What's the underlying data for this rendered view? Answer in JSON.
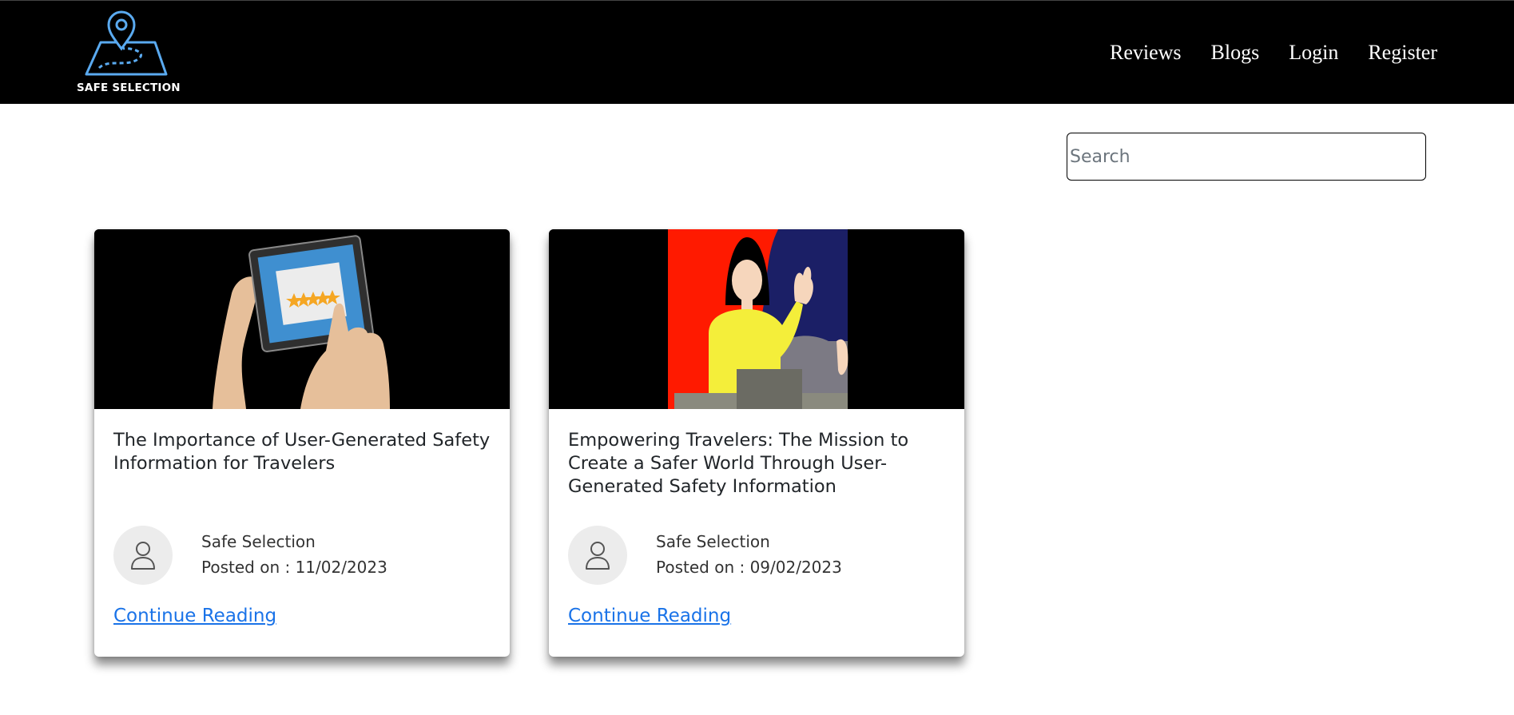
{
  "brand": {
    "name": "SAFE SELECTION",
    "logo_icon": "map-pin-route-icon"
  },
  "nav": {
    "items": [
      "Reviews",
      "Blogs",
      "Login",
      "Register"
    ]
  },
  "search": {
    "placeholder": "Search",
    "value": ""
  },
  "posts": [
    {
      "title": "The Importance of User-Generated Safety Information for Travelers",
      "image": "tablet-five-star-rating-illustration",
      "author": "Safe Selection",
      "posted": "Posted on : 11/02/2023",
      "link": "Continue Reading"
    },
    {
      "title": "Empowering Travelers: The Mission to Create a Safer World Through User-Generated Safety Information",
      "image": "woman-waving-speaker-illustration",
      "author": "Safe Selection",
      "posted": "Posted on : 09/02/2023",
      "link": "Continue Reading"
    }
  ],
  "colors": {
    "header_bg": "#000000",
    "logo_accent": "#5aaaf0",
    "link": "#1a73e8",
    "star": "#f5a623"
  }
}
